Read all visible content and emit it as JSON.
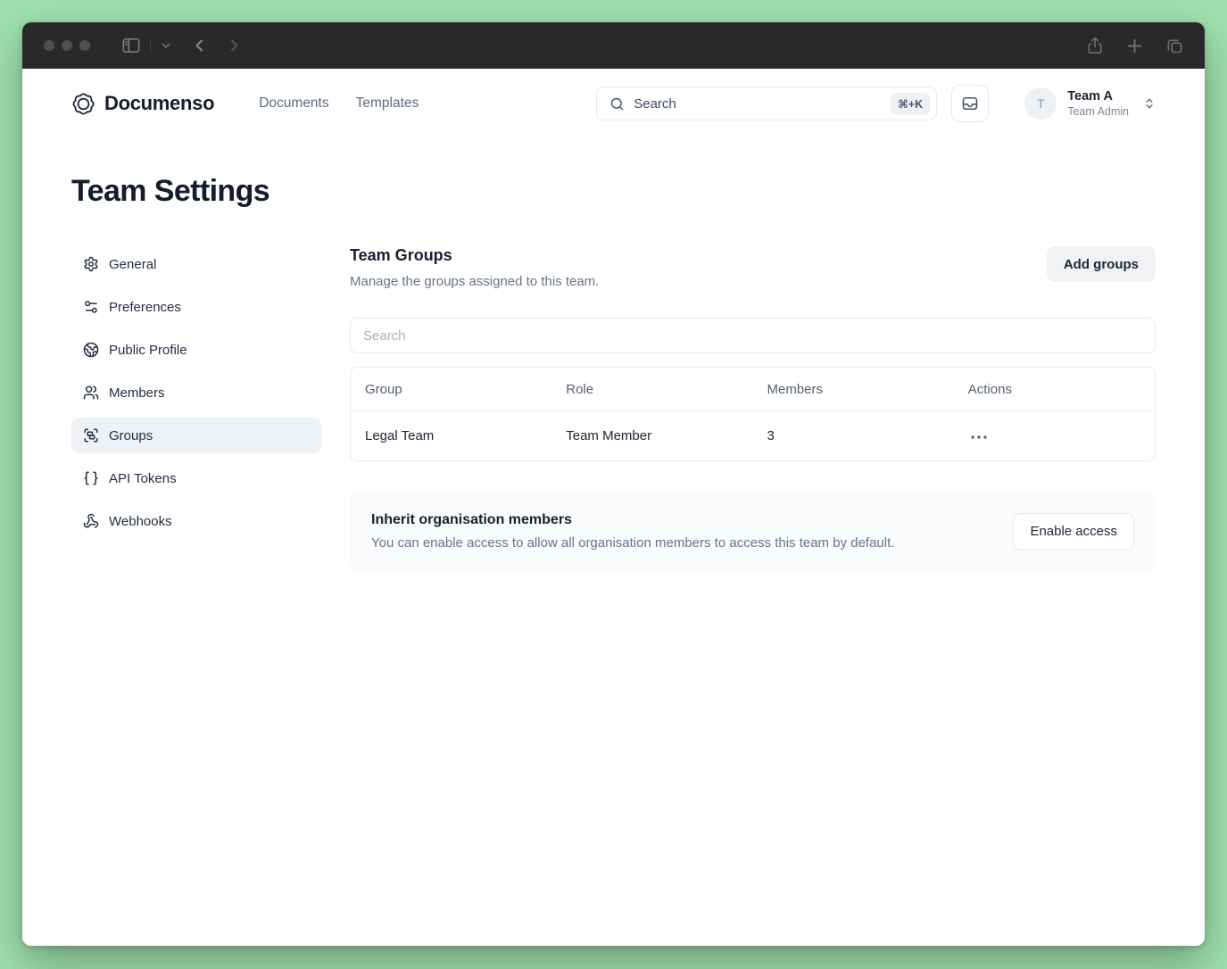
{
  "colors": {
    "desktop_background": "#9fe1ae",
    "titlebar_background": "#29292b",
    "brand_text": "#151d2d",
    "active_sidebar_background": "#eef1f5",
    "muted_text": "#67748b",
    "card_background": "#fafbfd"
  },
  "window": {
    "titlebar_icons": [
      "sidebar-toggle-icon",
      "chevron-down-icon",
      "back-icon",
      "forward-icon",
      "share-icon",
      "new-tab-icon",
      "tab-overview-icon"
    ]
  },
  "header": {
    "brand": "Documenso",
    "brand_icon": "documenso-seal-icon",
    "nav": [
      {
        "label": "Documents"
      },
      {
        "label": "Templates"
      }
    ],
    "search": {
      "placeholder": "Search",
      "shortcut": "⌘+K",
      "icon": "search-icon"
    },
    "inbox_icon": "inbox-icon",
    "account": {
      "initial": "T",
      "name": "Team A",
      "role": "Team Admin",
      "caret_icon": "chevrons-up-down-icon"
    }
  },
  "page": {
    "title": "Team Settings"
  },
  "sidebar": {
    "items": [
      {
        "label": "General",
        "icon": "gear-icon",
        "active": false
      },
      {
        "label": "Preferences",
        "icon": "sliders-icon",
        "active": false
      },
      {
        "label": "Public Profile",
        "icon": "globe-icon",
        "active": false
      },
      {
        "label": "Members",
        "icon": "users-icon",
        "active": false
      },
      {
        "label": "Groups",
        "icon": "group-frame-icon",
        "active": true
      },
      {
        "label": "API Tokens",
        "icon": "braces-icon",
        "active": false
      },
      {
        "label": "Webhooks",
        "icon": "webhook-icon",
        "active": false
      }
    ]
  },
  "main": {
    "section_title": "Team Groups",
    "section_description": "Manage the groups assigned to this team.",
    "add_button_label": "Add groups",
    "search_placeholder": "Search",
    "table": {
      "columns": [
        "Group",
        "Role",
        "Members",
        "Actions"
      ],
      "rows": [
        {
          "group": "Legal Team",
          "role": "Team Member",
          "members": "3",
          "actions_icon": "ellipsis-icon"
        }
      ]
    },
    "inherit": {
      "title": "Inherit organisation members",
      "description": "You can enable access to allow all organisation members to access this team by default.",
      "button_label": "Enable access"
    }
  }
}
